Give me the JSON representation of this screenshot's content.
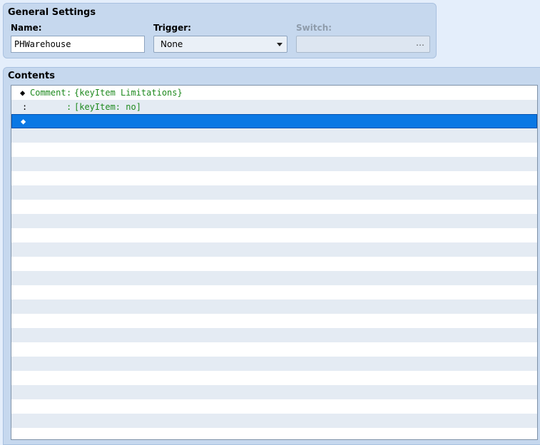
{
  "general": {
    "title": "General Settings",
    "name_label": "Name:",
    "name_value": "PHWarehouse",
    "trigger_label": "Trigger:",
    "trigger_value": "None",
    "switch_label": "Switch:",
    "switch_button": "…"
  },
  "contents": {
    "title": "Contents",
    "rows": [
      {
        "marker": "◆",
        "command": "Comment",
        "sep": ":",
        "text": "{keyItem Limitations}"
      },
      {
        "marker": ":",
        "command": "",
        "sep": ":",
        "text": "[keyItem: no]"
      },
      {
        "marker": "◆",
        "command": "",
        "sep": "",
        "text": ""
      }
    ]
  },
  "colors": {
    "selection": "#0a78e4",
    "comment_text": "#1f8a1f",
    "panel_bg": "#c6d8ee"
  }
}
